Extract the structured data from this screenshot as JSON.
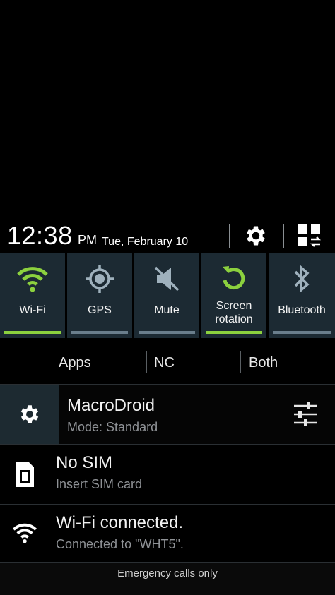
{
  "status": {
    "time": "12:38",
    "ampm": "PM",
    "date": "Tue, February 10"
  },
  "header": {
    "settings_icon": "gear-icon",
    "grid_icon": "quick-settings-grid-icon"
  },
  "toggles": [
    {
      "label": "Wi-Fi",
      "icon": "wifi-icon",
      "on": true
    },
    {
      "label": "GPS",
      "icon": "gps-icon",
      "on": false
    },
    {
      "label": "Mute",
      "icon": "mute-icon",
      "on": false
    },
    {
      "label_line1": "Screen",
      "label_line2": "rotation",
      "icon": "rotation-icon",
      "on": true
    },
    {
      "label": "Bluetooth",
      "icon": "bluetooth-icon",
      "on": false
    }
  ],
  "tabs": [
    "Apps",
    "NC",
    "Both"
  ],
  "notifications": {
    "macrodroid": {
      "title": "MacroDroid",
      "subtitle": "Mode: Standard"
    },
    "sim": {
      "title": "No SIM",
      "subtitle": "Insert SIM card"
    },
    "wifi": {
      "title": "Wi-Fi connected.",
      "subtitle": "Connected to \"WHT5\"."
    }
  },
  "footer": {
    "text": "Emergency calls only"
  },
  "colors": {
    "accent_green": "#8cd13e",
    "toggle_bg": "#1c2a33",
    "bar_off": "#6a7e8c"
  }
}
